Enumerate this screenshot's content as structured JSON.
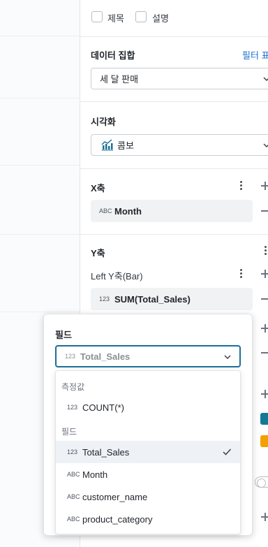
{
  "display_options": {
    "title_label": "제목",
    "description_label": "설명"
  },
  "dataset": {
    "heading": "데이터 집합",
    "filter_link": "필터 표",
    "selected": "세 달 판매"
  },
  "visualization": {
    "heading": "시각화",
    "selected": "콤보"
  },
  "x_axis": {
    "heading": "X축",
    "field_type": "ABC",
    "field": "Month"
  },
  "y_axis": {
    "heading": "Y축",
    "left_label": "Left Y축(Bar)",
    "field_type": "123",
    "field": "SUM(Total_Sales)"
  },
  "field_popover": {
    "title": "필드",
    "selected_type": "123",
    "selected_value": "Total_Sales",
    "groups": [
      {
        "label": "측정값",
        "items": [
          {
            "type": "123",
            "label": "COUNT(*)",
            "selected": false
          }
        ]
      },
      {
        "label": "필드",
        "items": [
          {
            "type": "123",
            "label": "Total_Sales",
            "selected": true
          },
          {
            "type": "ABC",
            "label": "Month",
            "selected": false
          },
          {
            "type": "ABC",
            "label": "customer_name",
            "selected": false
          },
          {
            "type": "ABC",
            "label": "product_category",
            "selected": false
          }
        ]
      }
    ]
  },
  "colors": {
    "accent_border": "#1b6f96",
    "link": "#1a6fd1",
    "series_teal": "#127a96",
    "series_orange": "#f4a000"
  },
  "icons": {
    "viz_icon": "combo-chart-icon",
    "check_icon": "check-icon",
    "kebab_icon": "kebab-menu-icon",
    "chevron_icon": "chevron-down-icon"
  }
}
